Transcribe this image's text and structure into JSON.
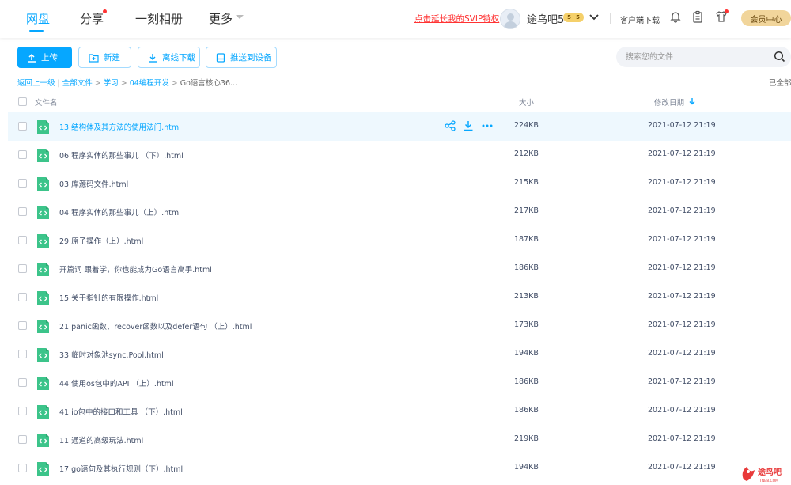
{
  "nav": {
    "items": [
      {
        "label": "网盘"
      },
      {
        "label": "分享"
      },
      {
        "label": "一刻相册"
      },
      {
        "label": "更多"
      }
    ],
    "svip_link": "点击延长我的SVIP特权",
    "username": "途鸟吧5",
    "vip_level_a": "5",
    "vip_level_b": "5",
    "client_download": "客户端下载",
    "member_center": "会员中心",
    "icons": [
      "bell-icon",
      "clipboard-icon",
      "shirt-icon"
    ]
  },
  "toolbar": {
    "upload": "上传",
    "new": "新建",
    "offline_download": "离线下载",
    "push_device": "推送到设备"
  },
  "search": {
    "placeholder": "搜索您的文件"
  },
  "breadcrumb": {
    "back": "返回上一级",
    "all_files": "全部文件",
    "study": "学习",
    "category": "04编程开发",
    "current": "Go语言核心36...",
    "loaded_all": "已全部"
  },
  "table": {
    "col_name": "文件名",
    "col_size": "大小",
    "col_date": "修改日期",
    "rows": [
      {
        "name": "13 结构体及其方法的使用法门.html",
        "size": "224KB",
        "date": "2021-07-12 21:19"
      },
      {
        "name": "06 程序实体的那些事儿 （下）.html",
        "size": "212KB",
        "date": "2021-07-12 21:19"
      },
      {
        "name": "03 库源码文件.html",
        "size": "215KB",
        "date": "2021-07-12 21:19"
      },
      {
        "name": "04 程序实体的那些事儿（上）.html",
        "size": "217KB",
        "date": "2021-07-12 21:19"
      },
      {
        "name": "29 原子操作（上）.html",
        "size": "187KB",
        "date": "2021-07-12 21:19"
      },
      {
        "name": "开篇词 跟着学，你也能成为Go语言高手.html",
        "size": "186KB",
        "date": "2021-07-12 21:19"
      },
      {
        "name": "15 关于指针的有限操作.html",
        "size": "213KB",
        "date": "2021-07-12 21:19"
      },
      {
        "name": "21 panic函数、recover函数以及defer语句 （上）.html",
        "size": "173KB",
        "date": "2021-07-12 21:19"
      },
      {
        "name": "33 临时对象池sync.Pool.html",
        "size": "194KB",
        "date": "2021-07-12 21:19"
      },
      {
        "name": "44 使用os包中的API （上）.html",
        "size": "186KB",
        "date": "2021-07-12 21:19"
      },
      {
        "name": "41 io包中的接口和工具 （下）.html",
        "size": "186KB",
        "date": "2021-07-12 21:19"
      },
      {
        "name": "11 通道的高级玩法.html",
        "size": "219KB",
        "date": "2021-07-12 21:19"
      },
      {
        "name": "17 go语句及其执行规则（下）.html",
        "size": "194KB",
        "date": "2021-07-12 21:19"
      }
    ]
  },
  "colors": {
    "accent": "#06a7ff",
    "file_icon": "#3cc48a",
    "hover_row": "#eef8fe",
    "svip_red": "#ff3333"
  }
}
